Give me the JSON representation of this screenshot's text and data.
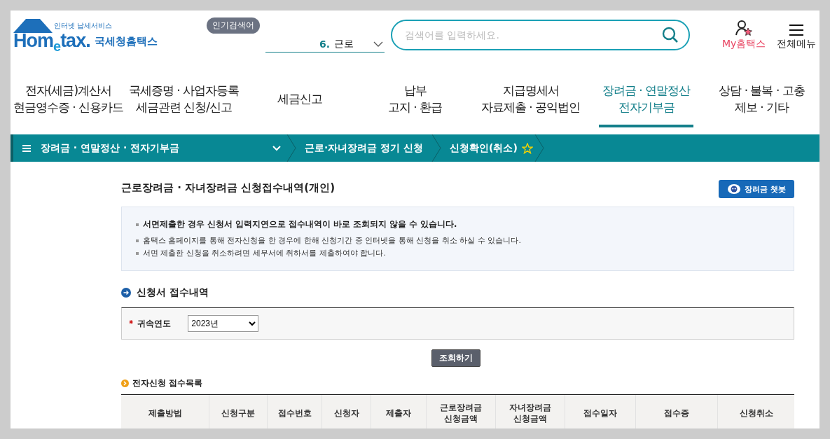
{
  "logo": {
    "tagline": "인터넷 납세서비스",
    "brand": "Hom$_{e}$tax.",
    "name": "국세청홈택스"
  },
  "popular_search": {
    "badge": "인기검색어",
    "rank": "6.",
    "term": "근로"
  },
  "search": {
    "placeholder": "검색어를 입력하세요."
  },
  "user_links": [
    {
      "kind": "my",
      "label": "My홈택스"
    },
    {
      "kind": "menu",
      "label": "전체메뉴"
    }
  ],
  "nav": [
    {
      "lines": [
        "전자(세금)계산서",
        "현금영수증 · 신용카드"
      ],
      "selected": false
    },
    {
      "lines": [
        "국세증명 · 사업자등록",
        "세금관련 신청/신고"
      ],
      "selected": false
    },
    {
      "lines": [
        "세금신고"
      ],
      "selected": false
    },
    {
      "lines": [
        "납부",
        "고지 · 환급"
      ],
      "selected": false
    },
    {
      "lines": [
        "지급명세서",
        "자료제출 · 공익법인"
      ],
      "selected": false
    },
    {
      "lines": [
        "장려금 · 연말정산",
        "전자기부금"
      ],
      "selected": true
    },
    {
      "lines": [
        "상담 · 불복 · 고충",
        "제보 · 기타"
      ],
      "selected": false
    }
  ],
  "breadcrumb": {
    "menu": "장려금 · 연말정산 · 전자기부금",
    "items": [
      "근로·자녀장려금 정기 신청",
      "신청확인(취소)"
    ],
    "favorite": false
  },
  "page_title": "근로장려금 · 자녀장려금 신청접수내역(개인)",
  "chatbot_button": "장려금 챗봇",
  "notices": [
    {
      "text": "서면제출한 경우 신청서 입력지연으로 접수내역이 바로 조회되지 않을 수 있습니다.",
      "bold": true
    },
    {
      "text": "홈택스 홈페이지를 통해 전자신청을 한 경우에 한해 신청기간 중 인터넷을 통해 신청을 취소 하실 수 있습니다.",
      "bold": false
    },
    {
      "text": "서면 제출한 신청을 취소하려면 세무서에 취하서를 제출하여야 합니다.",
      "bold": false
    }
  ],
  "section_title": "신청서 접수내역",
  "filter": {
    "label": "귀속연도",
    "required_mark": "*",
    "value": "2023년"
  },
  "query_button": "조회하기",
  "list_title": "전자신청 접수목록",
  "table": {
    "columns": [
      "제출방법",
      "신청구분",
      "접수번호",
      "신청자",
      "제출자",
      "근로장려금\n신청금액",
      "자녀장려금\n신청금액",
      "접수일자",
      "접수증",
      "신청취소"
    ]
  }
}
